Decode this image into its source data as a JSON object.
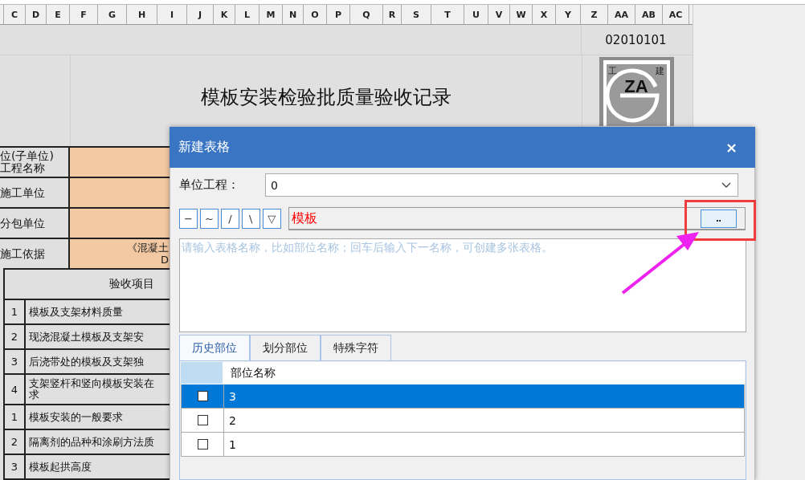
{
  "sheet": {
    "column_headers": [
      "C",
      "D",
      "E",
      "F",
      "G",
      "H",
      "I",
      "J",
      "K",
      "L",
      "M",
      "N",
      "O",
      "P",
      "Q",
      "R",
      "S",
      "T",
      "U",
      "V",
      "W",
      "X",
      "Y",
      "Z",
      "AA",
      "AB",
      "AC"
    ],
    "form_code": "02010101",
    "title": "模板安装检验批质量验收记录",
    "logo": {
      "initials": "ZA",
      "corner_marks": [
        "工",
        "建"
      ]
    },
    "info_rows": [
      {
        "label": "位(子单位)\n工程名称",
        "value": ""
      },
      {
        "label": "施工单位",
        "value": ""
      },
      {
        "label": "分包单位",
        "value": ""
      },
      {
        "label": "施工依据",
        "value": "《混凝土\nD"
      }
    ],
    "items_header": "验收项目",
    "items": [
      {
        "number": "1",
        "text": "模板及支架材料质量"
      },
      {
        "number": "2",
        "text": "现浇混凝土模板及支架安"
      },
      {
        "number": "3",
        "text": "后浇带处的模板及支架独"
      },
      {
        "number": "4",
        "text": "支架竖杆和竖向模板安装在",
        "text_continued": "求"
      },
      {
        "number": "1",
        "text": "模板安装的一般要求"
      },
      {
        "number": "2",
        "text": "隔离剂的品种和涂刷方法质"
      },
      {
        "number": "3",
        "text": "模板起拱高度"
      }
    ]
  },
  "dialog": {
    "title": "新建表格",
    "close": "×",
    "unit_project": {
      "label": "单位工程：",
      "value": "0"
    },
    "symbol_buttons": [
      "−",
      "~",
      "/",
      "\\",
      "▽"
    ],
    "name_field": {
      "value": "模板"
    },
    "browse_button": "..",
    "names_box": {
      "placeholder": "请输入表格名称，比如部位名称；回车后输入下一名称，可创建多张表格。"
    },
    "tabs": [
      {
        "label": "历史部位",
        "selected": true
      },
      {
        "label": "划分部位",
        "selected": false
      },
      {
        "label": "特殊字符",
        "selected": false
      }
    ],
    "grid": {
      "columns": [
        "部位名称"
      ],
      "rows": [
        {
          "name": "3",
          "checked": false,
          "selected": true
        },
        {
          "name": "2",
          "checked": false,
          "selected": false
        },
        {
          "name": "1",
          "checked": false,
          "selected": false
        }
      ]
    }
  }
}
